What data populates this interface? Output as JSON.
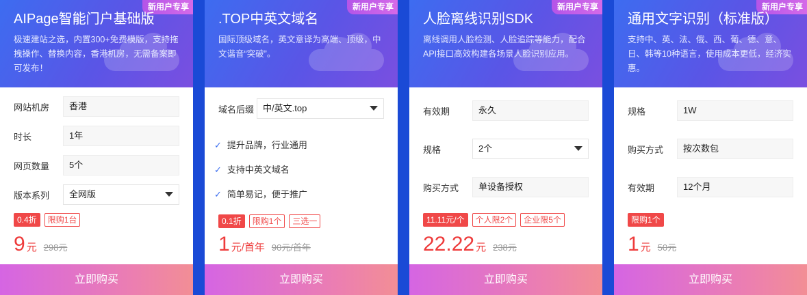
{
  "cards": [
    {
      "badge": "新用户专享",
      "title": "AIPage智能门户基础版",
      "desc": "极速建站之选，内置300+免费模版，支持拖拽操作、替换内容，香港机房，无需备案即可发布！",
      "rows": [
        {
          "label": "网站机房",
          "value": "香港"
        },
        {
          "label": "时长",
          "value": "1年"
        },
        {
          "label": "网页数量",
          "value": "5个"
        },
        {
          "label": "版本系列",
          "value": "全网版"
        }
      ],
      "tags": [
        "0.4折",
        "限购1台"
      ],
      "price": "9",
      "unit": "元",
      "old_price": "298元",
      "buy": "立即购买"
    },
    {
      "badge": "新用户专享",
      "title": ".TOP中英文域名",
      "desc": "国际顶级域名，英文意译为高端、顶级，中文谐音“突破”。",
      "rows": [
        {
          "label": "域名后缀",
          "value": "中/英文.top"
        }
      ],
      "features": [
        "提升品牌，行业通用",
        "支持中英文域名",
        "简单易记，便于推广"
      ],
      "tags": [
        "0.1折",
        "限购1个",
        "三选一"
      ],
      "price": "1",
      "unit": "元/首年",
      "old_price": "90元/首年",
      "buy": "立即购买"
    },
    {
      "badge": "新用户专享",
      "title": "人脸离线识别SDK",
      "desc": "离线调用人脸检测、人脸追踪等能力，配合API接口高效构建各场景人脸识别应用。",
      "rows": [
        {
          "label": "有效期",
          "value": "永久"
        },
        {
          "label": "规格",
          "value": "2个"
        },
        {
          "label": "购买方式",
          "value": "单设备授权"
        }
      ],
      "tags": [
        "11.11元/个",
        "个人限2个",
        "企业限5个"
      ],
      "price": "22.22",
      "unit": "元",
      "old_price": "238元",
      "buy": "立即购买"
    },
    {
      "badge": "新用户专享",
      "title": "通用文字识别（标准版）",
      "desc": "支持中、英、法、俄、西、葡、德、意、日、韩等10种语言，使用成本更低，经济实惠。",
      "rows": [
        {
          "label": "规格",
          "value": "1W"
        },
        {
          "label": "购买方式",
          "value": "按次数包"
        },
        {
          "label": "有效期",
          "value": "12个月"
        }
      ],
      "tags": [
        "限购1个"
      ],
      "price": "1",
      "unit": "元",
      "old_price": "50元",
      "buy": "立即购买"
    }
  ]
}
